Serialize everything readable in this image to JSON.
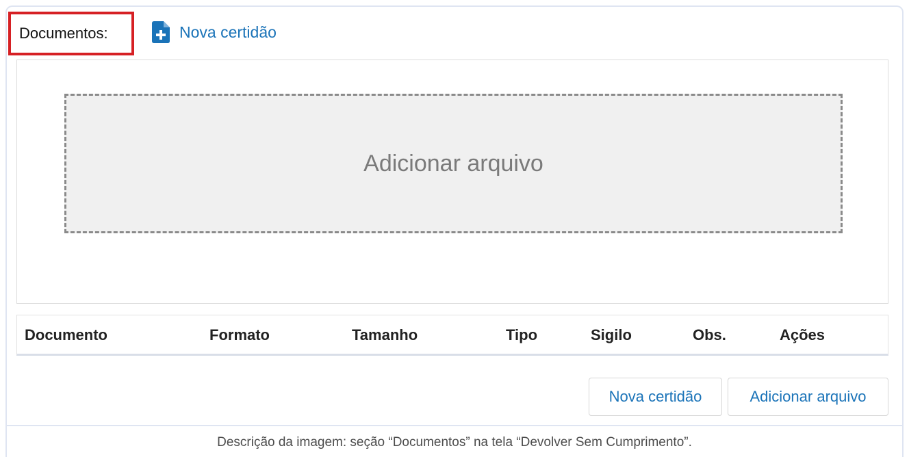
{
  "section": {
    "label": "Documentos:"
  },
  "actions": {
    "new_certificate_link": "Nova certidão",
    "new_certificate_icon": "file-plus-icon"
  },
  "dropzone": {
    "label": "Adicionar arquivo"
  },
  "table": {
    "columns": [
      "Documento",
      "Formato",
      "Tamanho",
      "Tipo",
      "Sigilo",
      "Obs.",
      "Ações"
    ]
  },
  "footer_buttons": {
    "new_certificate": "Nova certidão",
    "add_file": "Adicionar arquivo"
  },
  "caption": "Descrição da imagem: seção “Documentos” na tela “Devolver Sem Cumprimento”.",
  "colors": {
    "accent": "#1a73b8",
    "highlight_border": "#d62024"
  }
}
